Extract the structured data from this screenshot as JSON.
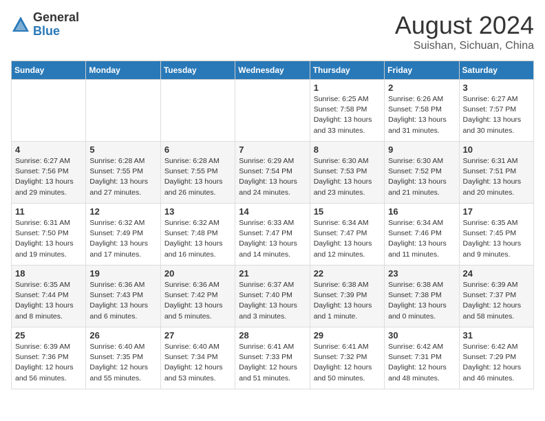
{
  "logo": {
    "general": "General",
    "blue": "Blue"
  },
  "header": {
    "month": "August 2024",
    "location": "Suishan, Sichuan, China"
  },
  "weekdays": [
    "Sunday",
    "Monday",
    "Tuesday",
    "Wednesday",
    "Thursday",
    "Friday",
    "Saturday"
  ],
  "weeks": [
    [
      {
        "day": "",
        "info": ""
      },
      {
        "day": "",
        "info": ""
      },
      {
        "day": "",
        "info": ""
      },
      {
        "day": "",
        "info": ""
      },
      {
        "day": "1",
        "info": "Sunrise: 6:25 AM\nSunset: 7:58 PM\nDaylight: 13 hours\nand 33 minutes."
      },
      {
        "day": "2",
        "info": "Sunrise: 6:26 AM\nSunset: 7:58 PM\nDaylight: 13 hours\nand 31 minutes."
      },
      {
        "day": "3",
        "info": "Sunrise: 6:27 AM\nSunset: 7:57 PM\nDaylight: 13 hours\nand 30 minutes."
      }
    ],
    [
      {
        "day": "4",
        "info": "Sunrise: 6:27 AM\nSunset: 7:56 PM\nDaylight: 13 hours\nand 29 minutes."
      },
      {
        "day": "5",
        "info": "Sunrise: 6:28 AM\nSunset: 7:55 PM\nDaylight: 13 hours\nand 27 minutes."
      },
      {
        "day": "6",
        "info": "Sunrise: 6:28 AM\nSunset: 7:55 PM\nDaylight: 13 hours\nand 26 minutes."
      },
      {
        "day": "7",
        "info": "Sunrise: 6:29 AM\nSunset: 7:54 PM\nDaylight: 13 hours\nand 24 minutes."
      },
      {
        "day": "8",
        "info": "Sunrise: 6:30 AM\nSunset: 7:53 PM\nDaylight: 13 hours\nand 23 minutes."
      },
      {
        "day": "9",
        "info": "Sunrise: 6:30 AM\nSunset: 7:52 PM\nDaylight: 13 hours\nand 21 minutes."
      },
      {
        "day": "10",
        "info": "Sunrise: 6:31 AM\nSunset: 7:51 PM\nDaylight: 13 hours\nand 20 minutes."
      }
    ],
    [
      {
        "day": "11",
        "info": "Sunrise: 6:31 AM\nSunset: 7:50 PM\nDaylight: 13 hours\nand 19 minutes."
      },
      {
        "day": "12",
        "info": "Sunrise: 6:32 AM\nSunset: 7:49 PM\nDaylight: 13 hours\nand 17 minutes."
      },
      {
        "day": "13",
        "info": "Sunrise: 6:32 AM\nSunset: 7:48 PM\nDaylight: 13 hours\nand 16 minutes."
      },
      {
        "day": "14",
        "info": "Sunrise: 6:33 AM\nSunset: 7:47 PM\nDaylight: 13 hours\nand 14 minutes."
      },
      {
        "day": "15",
        "info": "Sunrise: 6:34 AM\nSunset: 7:47 PM\nDaylight: 13 hours\nand 12 minutes."
      },
      {
        "day": "16",
        "info": "Sunrise: 6:34 AM\nSunset: 7:46 PM\nDaylight: 13 hours\nand 11 minutes."
      },
      {
        "day": "17",
        "info": "Sunrise: 6:35 AM\nSunset: 7:45 PM\nDaylight: 13 hours\nand 9 minutes."
      }
    ],
    [
      {
        "day": "18",
        "info": "Sunrise: 6:35 AM\nSunset: 7:44 PM\nDaylight: 13 hours\nand 8 minutes."
      },
      {
        "day": "19",
        "info": "Sunrise: 6:36 AM\nSunset: 7:43 PM\nDaylight: 13 hours\nand 6 minutes."
      },
      {
        "day": "20",
        "info": "Sunrise: 6:36 AM\nSunset: 7:42 PM\nDaylight: 13 hours\nand 5 minutes."
      },
      {
        "day": "21",
        "info": "Sunrise: 6:37 AM\nSunset: 7:40 PM\nDaylight: 13 hours\nand 3 minutes."
      },
      {
        "day": "22",
        "info": "Sunrise: 6:38 AM\nSunset: 7:39 PM\nDaylight: 13 hours\nand 1 minute."
      },
      {
        "day": "23",
        "info": "Sunrise: 6:38 AM\nSunset: 7:38 PM\nDaylight: 13 hours\nand 0 minutes."
      },
      {
        "day": "24",
        "info": "Sunrise: 6:39 AM\nSunset: 7:37 PM\nDaylight: 12 hours\nand 58 minutes."
      }
    ],
    [
      {
        "day": "25",
        "info": "Sunrise: 6:39 AM\nSunset: 7:36 PM\nDaylight: 12 hours\nand 56 minutes."
      },
      {
        "day": "26",
        "info": "Sunrise: 6:40 AM\nSunset: 7:35 PM\nDaylight: 12 hours\nand 55 minutes."
      },
      {
        "day": "27",
        "info": "Sunrise: 6:40 AM\nSunset: 7:34 PM\nDaylight: 12 hours\nand 53 minutes."
      },
      {
        "day": "28",
        "info": "Sunrise: 6:41 AM\nSunset: 7:33 PM\nDaylight: 12 hours\nand 51 minutes."
      },
      {
        "day": "29",
        "info": "Sunrise: 6:41 AM\nSunset: 7:32 PM\nDaylight: 12 hours\nand 50 minutes."
      },
      {
        "day": "30",
        "info": "Sunrise: 6:42 AM\nSunset: 7:31 PM\nDaylight: 12 hours\nand 48 minutes."
      },
      {
        "day": "31",
        "info": "Sunrise: 6:42 AM\nSunset: 7:29 PM\nDaylight: 12 hours\nand 46 minutes."
      }
    ]
  ]
}
